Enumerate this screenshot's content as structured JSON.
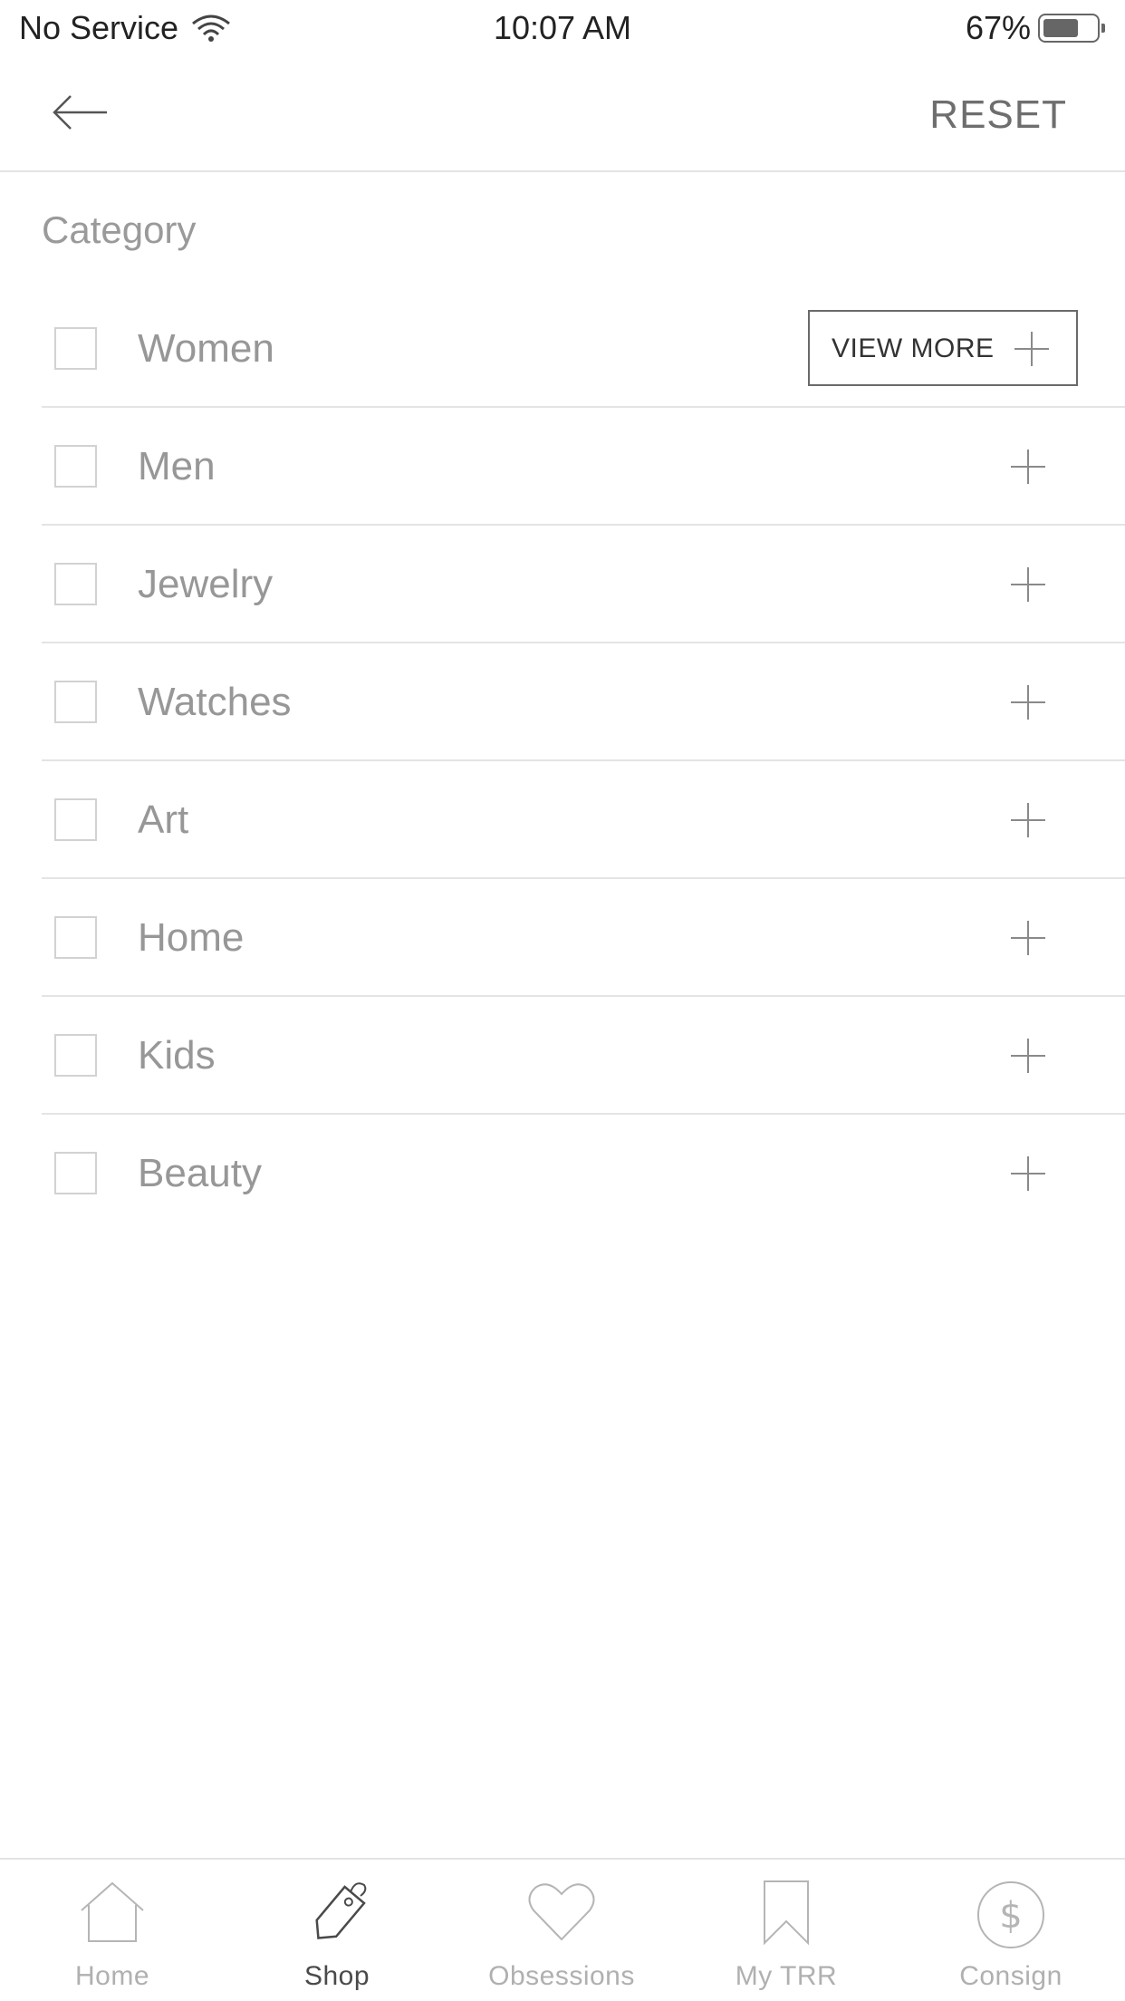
{
  "status_bar": {
    "carrier": "No Service",
    "time": "10:07 AM",
    "battery_percent": "67%",
    "battery_level": 0.67
  },
  "header": {
    "reset_label": "RESET",
    "back_icon": "arrow-left-icon"
  },
  "filter": {
    "section_title": "Category",
    "view_more_label": "VIEW MORE",
    "categories": [
      {
        "label": "Women",
        "checked": false
      },
      {
        "label": "Men",
        "checked": false
      },
      {
        "label": "Jewelry",
        "checked": false
      },
      {
        "label": "Watches",
        "checked": false
      },
      {
        "label": "Art",
        "checked": false
      },
      {
        "label": "Home",
        "checked": false
      },
      {
        "label": "Kids",
        "checked": false
      },
      {
        "label": "Beauty",
        "checked": false
      }
    ]
  },
  "tab_bar": {
    "active": "Shop",
    "tabs": [
      {
        "label": "Home",
        "icon": "house-icon"
      },
      {
        "label": "Shop",
        "icon": "price-tag-icon"
      },
      {
        "label": "Obsessions",
        "icon": "heart-icon"
      },
      {
        "label": "My TRR",
        "icon": "bookmark-icon"
      },
      {
        "label": "Consign",
        "icon": "dollar-circle-icon"
      }
    ]
  },
  "colors": {
    "text_muted": "#979797",
    "divider": "#e4e4e4",
    "active_tab": "#4a4a4a",
    "inactive_tab": "#b0b0b0"
  }
}
